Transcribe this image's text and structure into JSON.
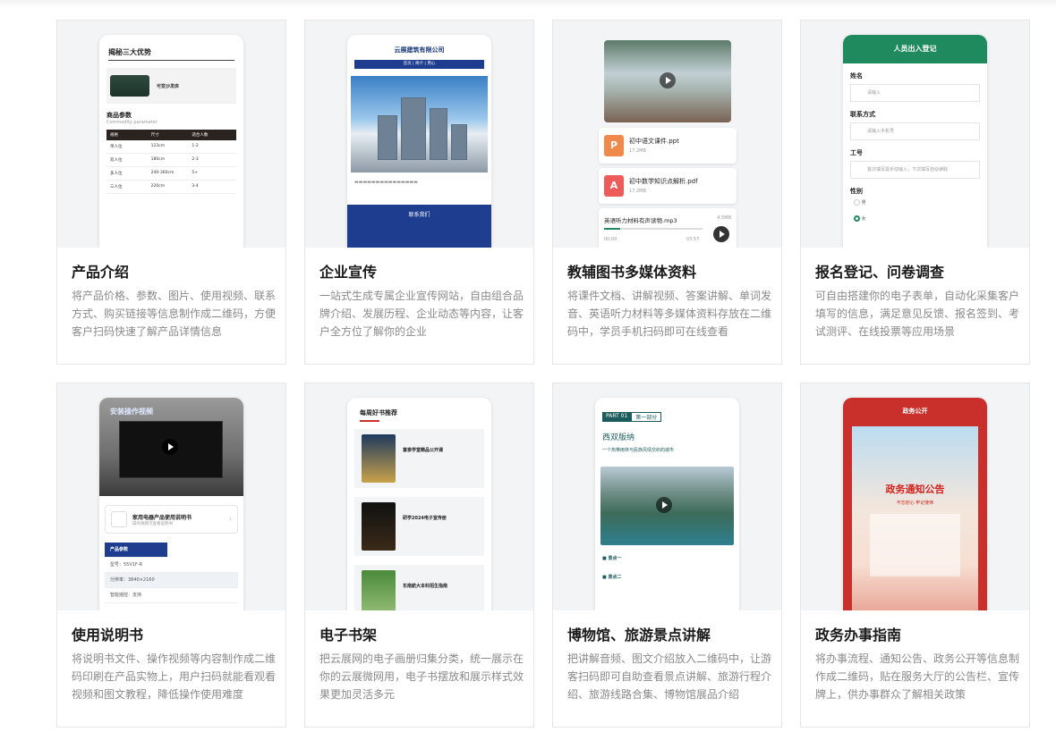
{
  "cards": [
    {
      "title": "产品介绍",
      "desc": "将产品价格、参数、图片、使用视频、联系方式、购买链接等信息制作成二维码，方便客户扫码快速了解产品详情信息"
    },
    {
      "title": "企业宣传",
      "desc": "一站式生成专属企业宣传网站，自由组合品牌介绍、发展历程、企业动态等内容，让客户全方位了解你的企业"
    },
    {
      "title": "教辅图书多媒体资料",
      "desc": "将课件文档、讲解视频、答案讲解、单词发音、英语听力材料等多媒体资料存放在二维码中，学员手机扫码即可在线查看"
    },
    {
      "title": "报名登记、问卷调查",
      "desc": "可自由搭建你的电子表单，自动化采集客户填写的信息，满足意见反馈、报名签到、考试测评、在线投票等应用场景"
    },
    {
      "title": "使用说明书",
      "desc": "将说明书文件、操作视频等内容制作成二维码印刷在产品实物上，用户扫码就能看观看视频和图文教程，降低操作使用难度"
    },
    {
      "title": "电子书架",
      "desc": "把云展网的电子画册归集分类，统一展示在你的云展微网用，电子书摆放和展示样式效果更加灵活多元"
    },
    {
      "title": "博物馆、旅游景点讲解",
      "desc": "把讲解音频、图文介绍放入二维码中，让游客扫码即可自助查看景点讲解、旅游行程介绍、旅游线路合集、博物馆展品介绍"
    },
    {
      "title": "政务办事指南",
      "desc": "将办事流程、通知公告、政务公开等信息制作成二维码，贴在服务大厅的公告栏、宣传牌上，供办事群众了解相关政策"
    }
  ],
  "previews": {
    "p1": {
      "heading": "揭秘三大优势",
      "product": "可变沙发床",
      "params": "商品参数",
      "params_en": "Commodity parameter",
      "th": [
        "规格",
        "尺寸",
        "适合人数"
      ],
      "rows": [
        [
          "单人位",
          "123cm",
          "1-2"
        ],
        [
          "双人位",
          "180cm",
          "2-3"
        ],
        [
          "多人位",
          "240-360cm",
          "5+"
        ],
        [
          "三人位",
          "220cm",
          "3-4"
        ]
      ]
    },
    "p2": {
      "company": "云展建筑有限公司",
      "nav": "首页 | 简介 | 用心",
      "contact": "联系我们"
    },
    "p3": {
      "files": [
        {
          "name": "初中语文课件.ppt",
          "size": "17.2MB",
          "icon": "P",
          "color": "#f08a4b"
        },
        {
          "name": "初中数学知识点解析.pdf",
          "size": "17.2MB",
          "icon": "A",
          "color": "#ee5b5b"
        }
      ],
      "audio": "英语听力材料有声读物.mp3",
      "audio_size": "4.5MB",
      "t0": "00:00",
      "t1": "03:57"
    },
    "p4": {
      "header": "人员出入登记",
      "fields": [
        {
          "label": "姓名",
          "ph": "请输入"
        },
        {
          "label": "联系方式",
          "ph": "请输入手机号"
        },
        {
          "label": "工号",
          "ph": "首次填写需手动输入，下次填写自动读取"
        }
      ],
      "gender": "性别",
      "male": "男",
      "female": "女"
    },
    "p5": {
      "tv_title": "安装操作视频",
      "book": "家用电器产品使用说明书",
      "book_sub": "操作视频可查看说明书",
      "spec_title": "产品参数",
      "specs": [
        "型号：55V1F-R",
        "分辨率：3840×2160",
        "智能摇控：支持"
      ]
    },
    "p6": {
      "heading": "每周好书推荐",
      "books": [
        "富泰学堂精品公开课",
        "研学2024电子宣传册",
        "东南航大本科招生指南"
      ]
    },
    "p7": {
      "part": "PART 01",
      "part_label": "第一部分",
      "title": "西双版纳",
      "sub": "一个热带雨林与民族风情交织的城市",
      "a": "■ 景点一",
      "b": "■ 景点二"
    },
    "p8": {
      "header": "政务公开",
      "poster_title": "政务通知公告",
      "poster_sub": "不忘初心 牢记使命"
    }
  }
}
